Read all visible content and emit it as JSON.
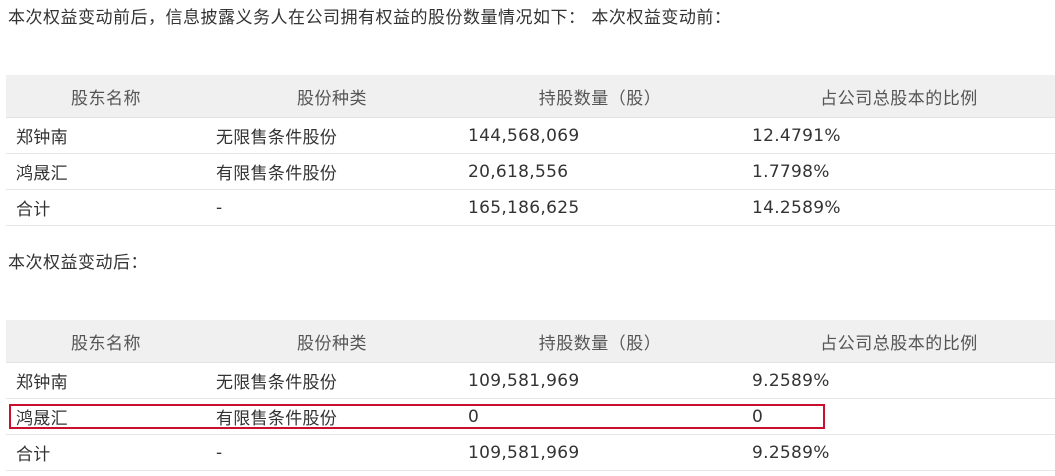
{
  "intro_text": "本次权益变动前后，信息披露义务人在公司拥有权益的股份数量情况如下：  本次权益变动前：",
  "after_label": "本次权益变动后：",
  "headers": {
    "name": "股东名称",
    "type": "股份种类",
    "shares": "持股数量（股）",
    "ratio": "占公司总股本的比例"
  },
  "before": {
    "rows": [
      {
        "name": "郑钟南",
        "type": "无限售条件股份",
        "shares": "144,568,069",
        "ratio": "12.4791%"
      },
      {
        "name": "鸿晟汇",
        "type": "有限售条件股份",
        "shares": "20,618,556",
        "ratio": "1.7798%"
      },
      {
        "name": "合计",
        "type": "-",
        "shares": "165,186,625",
        "ratio": "14.2589%"
      }
    ]
  },
  "after": {
    "rows": [
      {
        "name": "郑钟南",
        "type": "无限售条件股份",
        "shares": "109,581,969",
        "ratio": "9.2589%"
      },
      {
        "name": "鸿晟汇",
        "type": "有限售条件股份",
        "shares": "0",
        "ratio": "0"
      },
      {
        "name": "合计",
        "type": "-",
        "shares": "109,581,969",
        "ratio": "9.2589%"
      }
    ]
  },
  "colors": {
    "header_bg": "#f0f0f0",
    "highlight_border": "#c8102e",
    "text": "#333333"
  }
}
